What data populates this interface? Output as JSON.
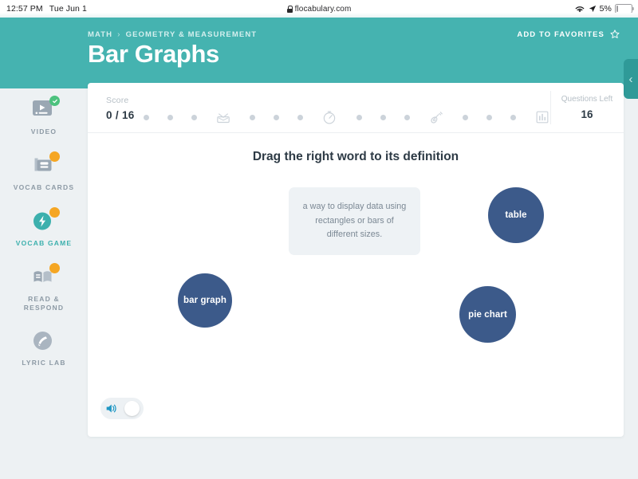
{
  "status_bar": {
    "time": "12:57 PM",
    "date": "Tue Jun 1",
    "url": "flocabulary.com",
    "lock_icon": "lock-icon",
    "wifi_icon": "wifi-icon",
    "location_icon": "location-arrow-icon",
    "battery_percent": "5%"
  },
  "header": {
    "breadcrumb": [
      "MATH",
      "GEOMETRY & MEASUREMENT"
    ],
    "breadcrumb_separator": "›",
    "title": "Bar Graphs",
    "favorites_label": "ADD TO FAVORITES",
    "favorites_icon": "star-outline-icon",
    "side_tab_icon": "chevron-left-icon",
    "teal": "#45b3b0",
    "teal_dark": "#2f9a98"
  },
  "sidebar": {
    "items": [
      {
        "label": "VIDEO",
        "icon": "video-icon",
        "badge": "check",
        "active": false
      },
      {
        "label": "VOCAB CARDS",
        "icon": "vocab-cards-icon",
        "badge": "dot",
        "active": false
      },
      {
        "label": "VOCAB GAME",
        "icon": "vocab-game-icon",
        "badge": "dot",
        "active": true
      },
      {
        "label": "READ &\nRESPOND",
        "icon": "read-respond-icon",
        "badge": "dot",
        "active": false
      },
      {
        "label": "LYRIC LAB",
        "icon": "lyric-lab-icon",
        "badge": "none",
        "active": false
      }
    ]
  },
  "scorebar": {
    "score_label": "Score",
    "score_value": "0 / 16",
    "questions_left_label": "Questions Left",
    "questions_left_value": "16",
    "progress": [
      "dot",
      "dot",
      "dot",
      "tv-icon",
      "dot",
      "dot",
      "dot",
      "stopwatch-icon",
      "dot",
      "dot",
      "dot",
      "guitar-icon",
      "dot",
      "dot",
      "dot",
      "bar-chart-icon"
    ]
  },
  "game": {
    "prompt": "Drag the right word to its definition",
    "definition": "a way to display data using rectangles or bars of different sizes.",
    "words": [
      {
        "label": "bar graph"
      },
      {
        "label": "table"
      },
      {
        "label": "pie chart"
      }
    ],
    "bubble_color": "#3c5a8a",
    "audio_toggle": {
      "icon": "speaker-icon",
      "state": "off"
    }
  }
}
